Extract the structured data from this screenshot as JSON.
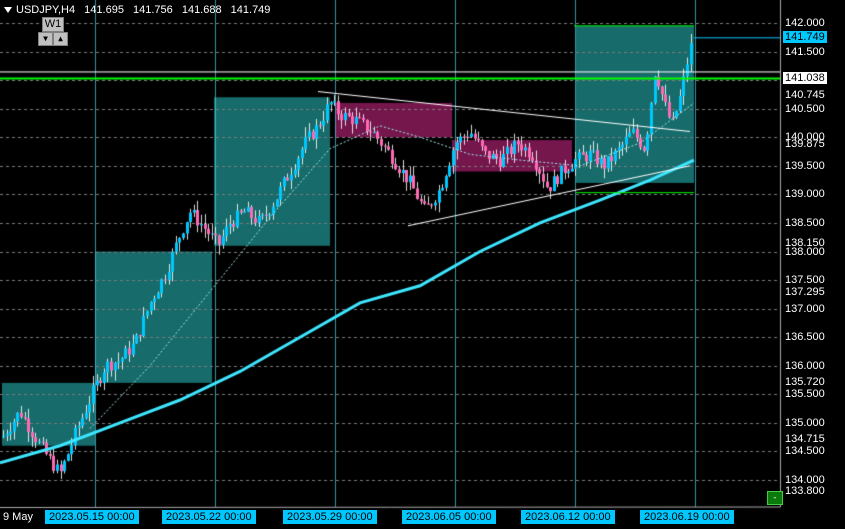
{
  "header": {
    "symbol_tf": "USDJPY,H4",
    "open": "141.695",
    "high": "141.756",
    "low": "141.688",
    "close": "141.749"
  },
  "timeframe_button": "W1",
  "price_axis": [
    {
      "label": "142.000",
      "kind": "tick"
    },
    {
      "label": "141.749",
      "kind": "current"
    },
    {
      "label": "141.500",
      "kind": "tick"
    },
    {
      "label": "141.038",
      "kind": "level"
    },
    {
      "label": "140.745",
      "kind": "tick"
    },
    {
      "label": "140.500",
      "kind": "tick"
    },
    {
      "label": "140.000",
      "kind": "tick"
    },
    {
      "label": "139.875",
      "kind": "tick"
    },
    {
      "label": "139.500",
      "kind": "tick"
    },
    {
      "label": "139.000",
      "kind": "tick"
    },
    {
      "label": "138.500",
      "kind": "tick"
    },
    {
      "label": "138.150",
      "kind": "tick"
    },
    {
      "label": "138.000",
      "kind": "tick"
    },
    {
      "label": "137.500",
      "kind": "tick"
    },
    {
      "label": "137.295",
      "kind": "tick"
    },
    {
      "label": "137.000",
      "kind": "tick"
    },
    {
      "label": "136.500",
      "kind": "tick"
    },
    {
      "label": "136.000",
      "kind": "tick"
    },
    {
      "label": "135.720",
      "kind": "tick"
    },
    {
      "label": "135.500",
      "kind": "tick"
    },
    {
      "label": "135.000",
      "kind": "tick"
    },
    {
      "label": "134.715",
      "kind": "tick"
    },
    {
      "label": "134.500",
      "kind": "tick"
    },
    {
      "label": "134.000",
      "kind": "tick"
    },
    {
      "label": "133.800",
      "kind": "tick"
    }
  ],
  "time_axis": [
    {
      "label": "9 May",
      "kind": "plain"
    },
    {
      "label": "2023.05.15 00:00",
      "kind": "marker"
    },
    {
      "label": "2023.05.22 00:00",
      "kind": "marker"
    },
    {
      "label": "2023.05.29 00:00",
      "kind": "marker"
    },
    {
      "label": "2023.06.05 00:00",
      "kind": "marker"
    },
    {
      "label": "2023.06.12 00:00",
      "kind": "marker"
    },
    {
      "label": "2023.06.19 00:00",
      "kind": "marker"
    }
  ],
  "colors": {
    "background": "#000000",
    "grid": "#7a7a7a",
    "bull": "#00c8ff",
    "bear": "#ff69b4",
    "ma": "#3ee6ff",
    "level_line": "#00ff00",
    "current_price": "#00c8ff",
    "zone_bull": "#1f8f8f",
    "zone_bear": "#8a1a5a"
  },
  "icons": {
    "dropdown": "triangle-down-icon",
    "scroll_left": "arrow-left-icon",
    "scroll_right": "arrow-right-icon"
  }
}
